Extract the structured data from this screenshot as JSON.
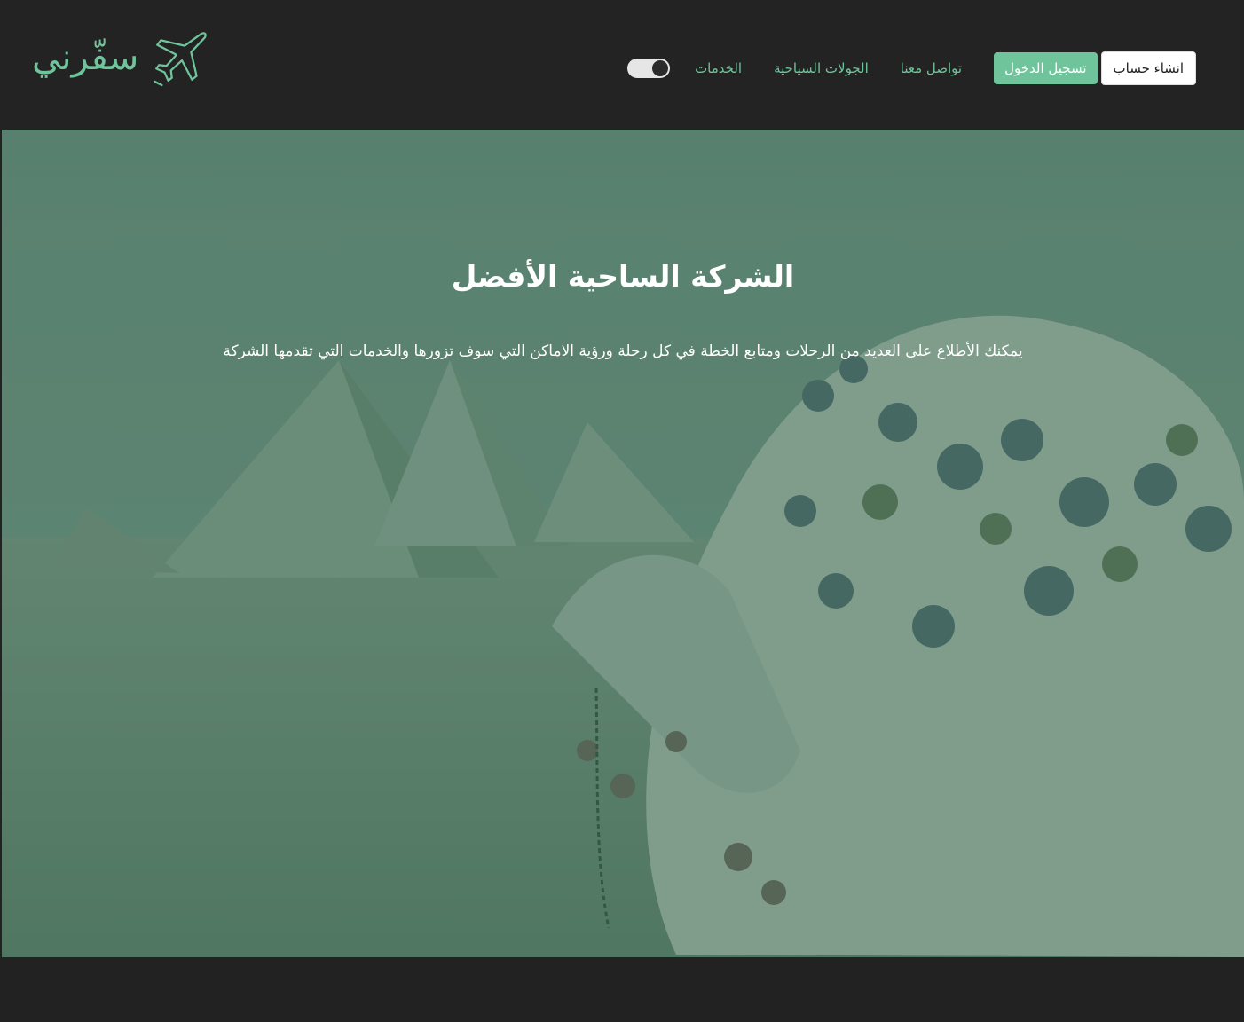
{
  "brand": {
    "name": "سفّرني",
    "icon": "airplane-icon",
    "color": "#6fc49b"
  },
  "nav": {
    "signup_label": "انشاء حساب",
    "login_label": "تسجيل الدخول",
    "links": [
      "تواصل معنا",
      "الجولات السياحية",
      "الخدمات"
    ],
    "theme_toggle_icon": "toggle-switch"
  },
  "hero": {
    "title": "الشركة الساحية الأفضل",
    "subtitle": "يمكنك الأطلاع على العديد من الرحلات ومتابع الخطة في كل رحلة ورؤية الاماكن التي سوف تزورها والخدمات التي تقدمها الشركة",
    "overlay_color": "#2a5f46"
  }
}
